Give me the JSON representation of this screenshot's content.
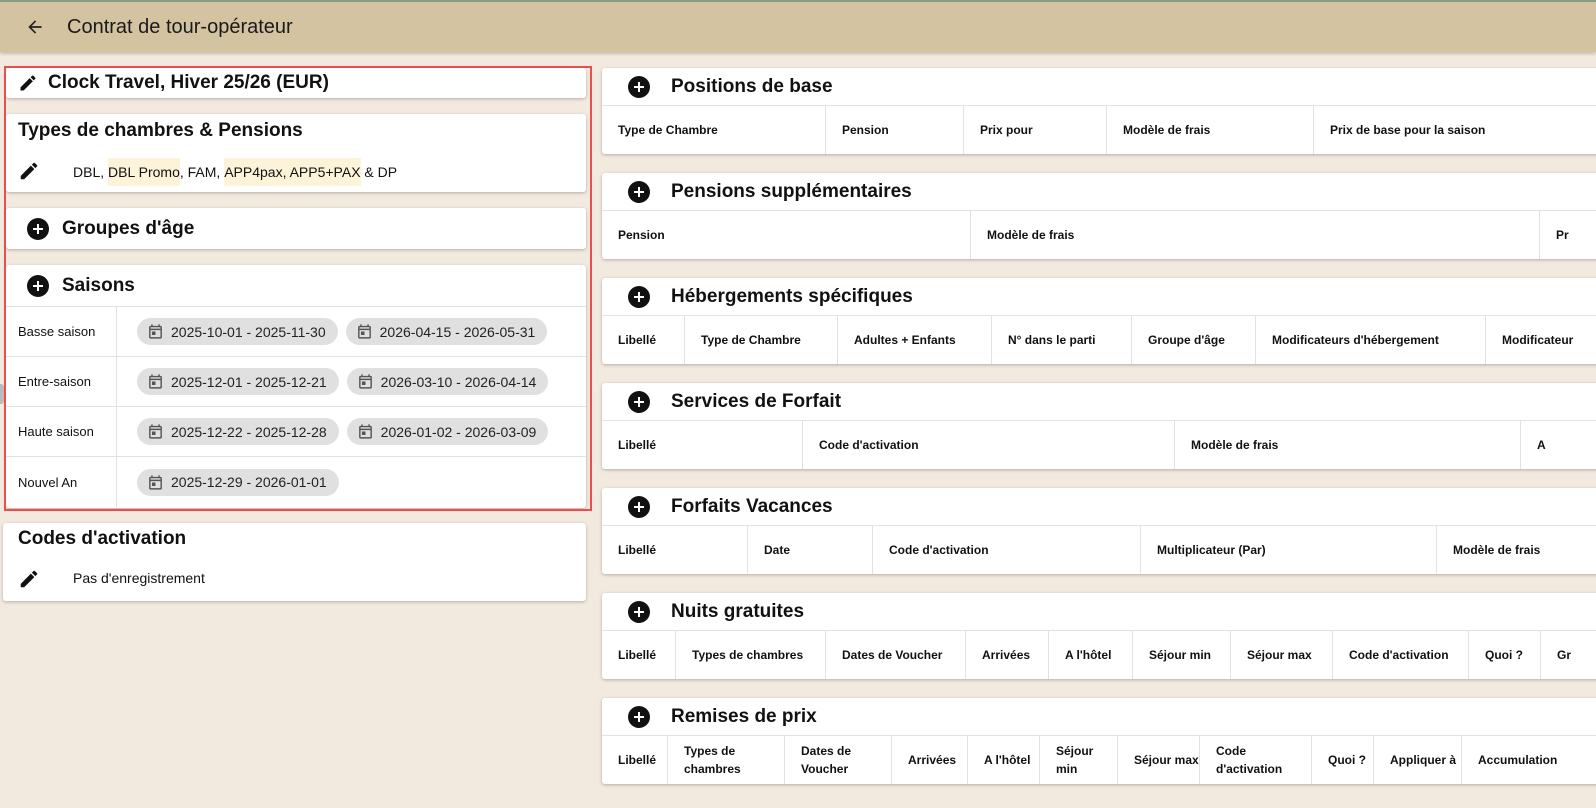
{
  "appbar": {
    "title": "Contrat de tour-opérateur"
  },
  "contract": {
    "name": "Clock Travel, Hiver 25/26 (EUR)"
  },
  "rooms": {
    "title": "Types de chambres & Pensions",
    "line": {
      "p0": "DBL, ",
      "p1": "DBL Promo",
      "p2": ", FAM, ",
      "p3": "APP4pax, APP5+PAX",
      "p4": " & DP"
    }
  },
  "age_groups": {
    "title": "Groupes d'âge"
  },
  "seasons": {
    "title": "Saisons",
    "rows": [
      {
        "name": "Basse saison",
        "ranges": [
          "2025-10-01 - 2025-11-30",
          "2026-04-15 - 2026-05-31"
        ]
      },
      {
        "name": "Entre-saison",
        "ranges": [
          "2025-12-01 - 2025-12-21",
          "2026-03-10 - 2026-04-14"
        ]
      },
      {
        "name": "Haute saison",
        "ranges": [
          "2025-12-22 - 2025-12-28",
          "2026-01-02 - 2026-03-09"
        ]
      },
      {
        "name": "Nouvel An",
        "ranges": [
          "2025-12-29 - 2026-01-01"
        ]
      }
    ]
  },
  "activation_codes": {
    "title": "Codes d'activation",
    "value": "Pas d'enregistrement"
  },
  "sections": [
    {
      "title": "Positions de base",
      "cols": [
        "Type de Chambre",
        "Pension",
        "Prix pour",
        "Modèle de frais",
        "Prix de base pour la saison"
      ]
    },
    {
      "title": "Pensions supplémentaires",
      "cols": [
        "Pension",
        "Modèle de frais",
        "Pr"
      ]
    },
    {
      "title": "Hébergements spécifiques",
      "cols": [
        "Libellé",
        "Type de Chambre",
        "Adultes + Enfants",
        "N° dans le parti",
        "Groupe d'âge",
        "Modificateurs d'hébergement",
        "Modificateur"
      ]
    },
    {
      "title": "Services de Forfait",
      "cols": [
        "Libellé",
        "Code d'activation",
        "Modèle de frais",
        "A"
      ]
    },
    {
      "title": "Forfaits Vacances",
      "cols": [
        "Libellé",
        "Date",
        "Code d'activation",
        "Multiplicateur (Par)",
        "Modèle de frais"
      ]
    },
    {
      "title": "Nuits gratuites",
      "cols": [
        "Libellé",
        "Types de chambres",
        "Dates de Voucher",
        "Arrivées",
        "A l'hôtel",
        "Séjour min",
        "Séjour max",
        "Code d'activation",
        "Quoi ?",
        "Gr"
      ]
    },
    {
      "title": "Remises de prix",
      "cols": [
        "Libellé",
        "Types de chambres",
        "Dates de Voucher",
        "Arrivées",
        "A l'hôtel",
        "Séjour min",
        "Séjour max",
        "Code d'activation",
        "Quoi ?",
        "Appliquer à",
        "Accumulation"
      ]
    }
  ]
}
